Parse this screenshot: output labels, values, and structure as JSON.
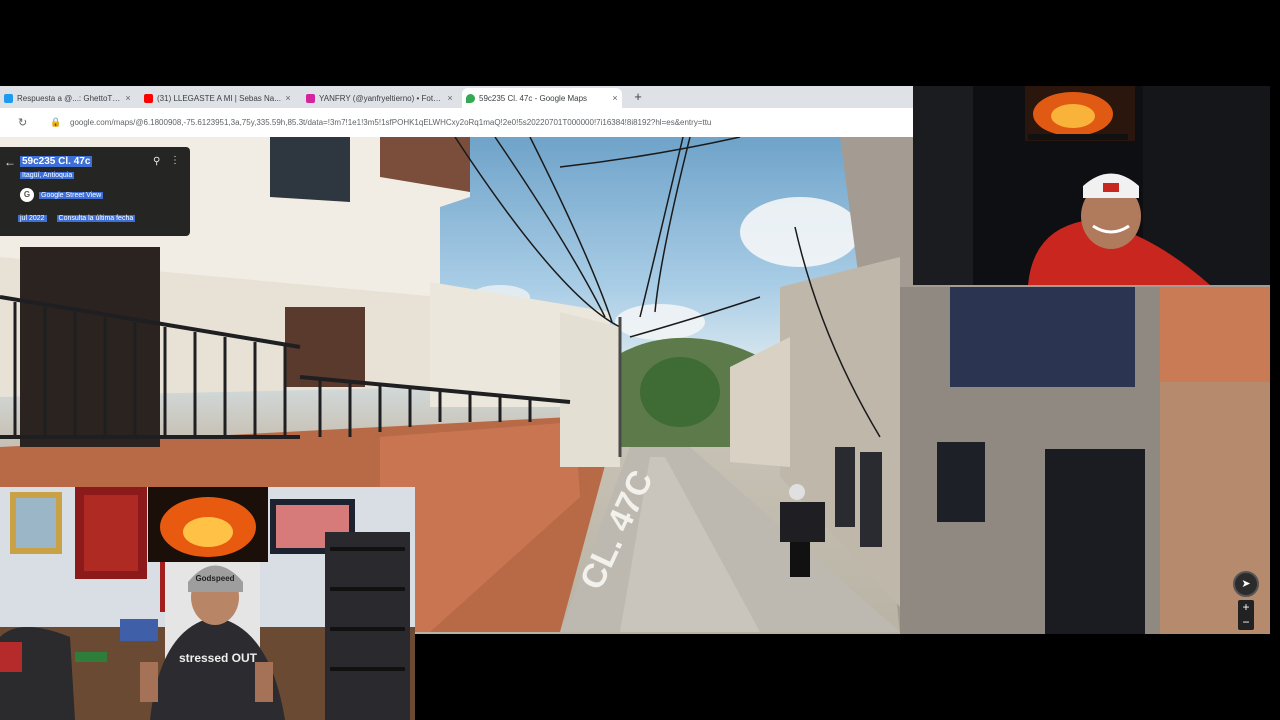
{
  "browser": {
    "tabs": [
      {
        "title": "Respuesta a @...: GhettoTC...",
        "favicon_color": "#1d9bf0",
        "active": false
      },
      {
        "title": "(31) LLEGASTE A MI | Sebas Na...",
        "favicon_color": "#ff0000",
        "active": false
      },
      {
        "title": "YANFRY (@yanfryeltierno) • Foto...",
        "favicon_color": "#d6249f",
        "active": false
      },
      {
        "title": "59c235 Cl. 47c - Google Maps",
        "favicon_color": "#34a853",
        "active": true
      }
    ],
    "close_glyph": "×",
    "new_tab_glyph": "+",
    "url": "google.com/maps/@6.1800908,-75.6123951,3a,75y,335.59h,85.3t/data=!3m7!1e1!3m5!1sfPOHK1qELWHCxy2oRq1maQ!2e0!5s20220701T000000!7i16384!8i8192?hl=es&entry=ttu"
  },
  "maps_card": {
    "title": "59c235 Cl. 47c",
    "subtitle": "Itagüí, Antioquia",
    "source_label": "Google Street View",
    "date": "jul 2022",
    "latest_link": "Consulta la última fecha"
  },
  "street": {
    "road_marking": "CL. 47C"
  },
  "controls": {
    "zoom_in": "+",
    "zoom_out": "−"
  },
  "webcam_left": {
    "cap_text": "Godspeed",
    "shirt_text": "stressed OUT"
  }
}
